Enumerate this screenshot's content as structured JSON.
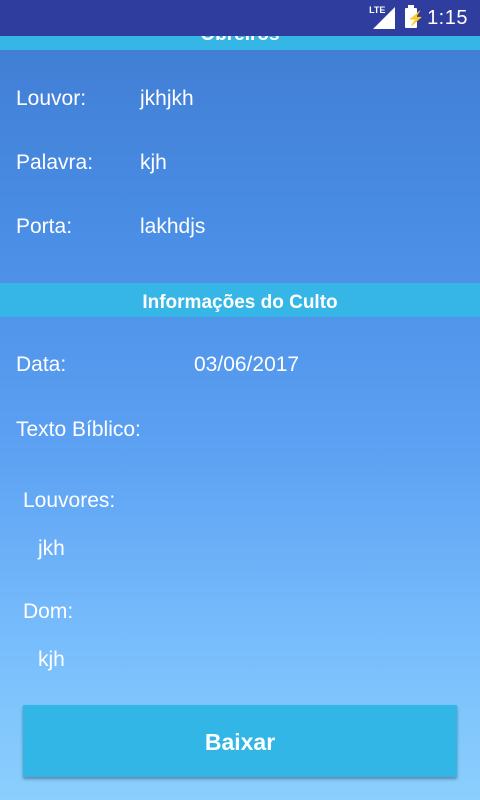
{
  "status_bar": {
    "network": "LTE",
    "time": "1:15"
  },
  "obreiros": {
    "title": "Obreiros",
    "louvor_label": "Louvor:",
    "louvor_value": "jkhjkh",
    "palavra_label": "Palavra:",
    "palavra_value": "kjh",
    "porta_label": "Porta:",
    "porta_value": "lakhdjs"
  },
  "culto": {
    "title": "Informações do Culto",
    "data_label": "Data:",
    "data_value": "03/06/2017",
    "texto_label": "Texto Bíblico:",
    "louvores_label": "Louvores:",
    "louvores_value": "jkh",
    "dom_label": "Dom:",
    "dom_value": "kjh"
  },
  "actions": {
    "download_label": "Baixar"
  },
  "colors": {
    "status_bar": "#2f3e9e",
    "section_header": "#36b6e6",
    "button": "#32b6e6"
  }
}
